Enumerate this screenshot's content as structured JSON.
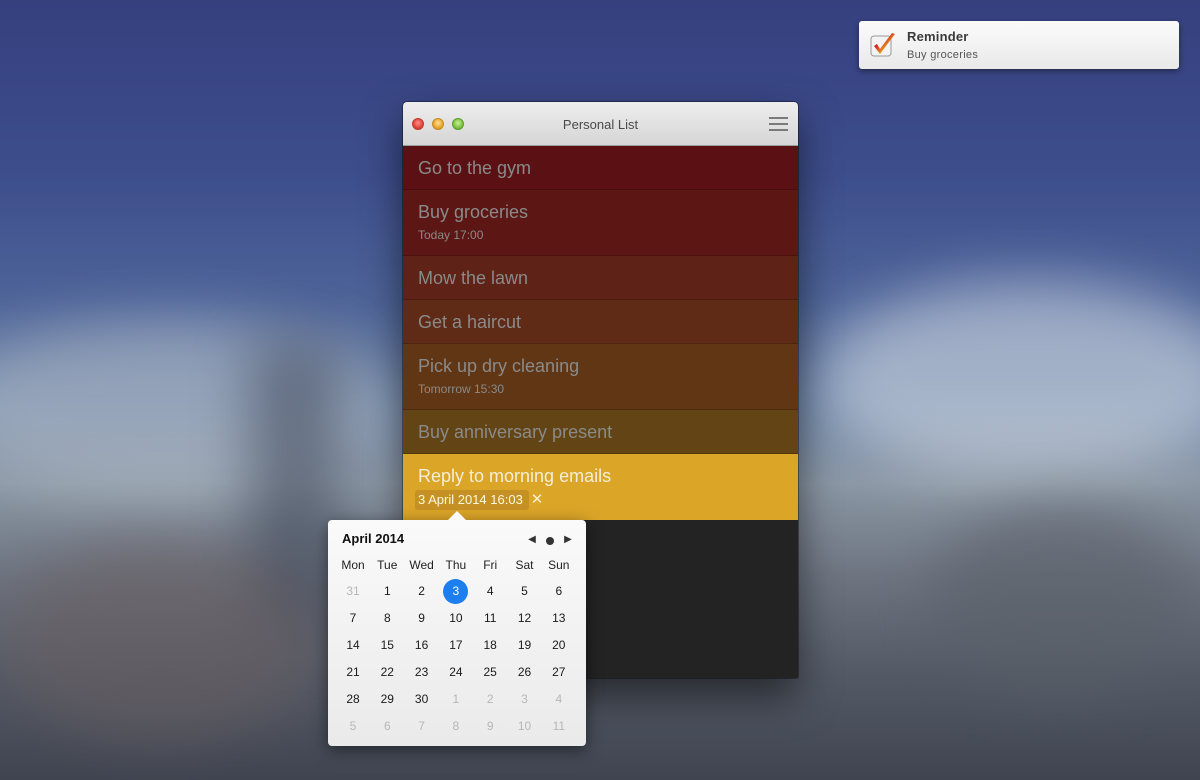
{
  "notification": {
    "title": "Reminder",
    "body": "Buy groceries",
    "icon": "checkmark-app-icon"
  },
  "window": {
    "title": "Personal List",
    "menu_icon": "hamburger-menu-icon"
  },
  "tasks": [
    {
      "title": "Go to the gym",
      "subtitle": "",
      "color": "#5b1113"
    },
    {
      "title": "Buy groceries",
      "subtitle": "Today 17:00",
      "color": "#5c1614"
    },
    {
      "title": "Mow the lawn",
      "subtitle": "",
      "color": "#5e2217"
    },
    {
      "title": "Get a haircut",
      "subtitle": "",
      "color": "#5f2b16"
    },
    {
      "title": "Pick up dry cleaning",
      "subtitle": "Tomorrow 15:30",
      "color": "#603614"
    },
    {
      "title": "Buy anniversary present",
      "subtitle": "",
      "color": "#634414"
    },
    {
      "title": "Reply to morning emails",
      "subtitle": "3 April 2014 16:03",
      "color": "#dba528",
      "clear_icon": "close-icon"
    }
  ],
  "calendar": {
    "month_label": "April 2014",
    "prev_icon": "triangle-left-icon",
    "today_icon": "dot-icon",
    "next_icon": "triangle-right-icon",
    "selected_color": "#1d7ef0",
    "weekdays": [
      "Mon",
      "Tue",
      "Wed",
      "Thu",
      "Fri",
      "Sat",
      "Sun"
    ],
    "weeks": [
      [
        "31",
        "1",
        "2",
        "3",
        "4",
        "5",
        "6"
      ],
      [
        "7",
        "8",
        "9",
        "10",
        "11",
        "12",
        "13"
      ],
      [
        "14",
        "15",
        "16",
        "17",
        "18",
        "19",
        "20"
      ],
      [
        "21",
        "22",
        "23",
        "24",
        "25",
        "26",
        "27"
      ],
      [
        "28",
        "29",
        "30",
        "1",
        "2",
        "3",
        "4"
      ],
      [
        "5",
        "6",
        "7",
        "8",
        "9",
        "10",
        "11"
      ]
    ],
    "muted": [
      [
        0,
        0
      ],
      [
        4,
        3
      ],
      [
        4,
        4
      ],
      [
        4,
        5
      ],
      [
        4,
        6
      ],
      [
        5,
        0
      ],
      [
        5,
        1
      ],
      [
        5,
        2
      ],
      [
        5,
        3
      ],
      [
        5,
        4
      ],
      [
        5,
        5
      ],
      [
        5,
        6
      ]
    ],
    "selected": [
      0,
      3
    ]
  }
}
